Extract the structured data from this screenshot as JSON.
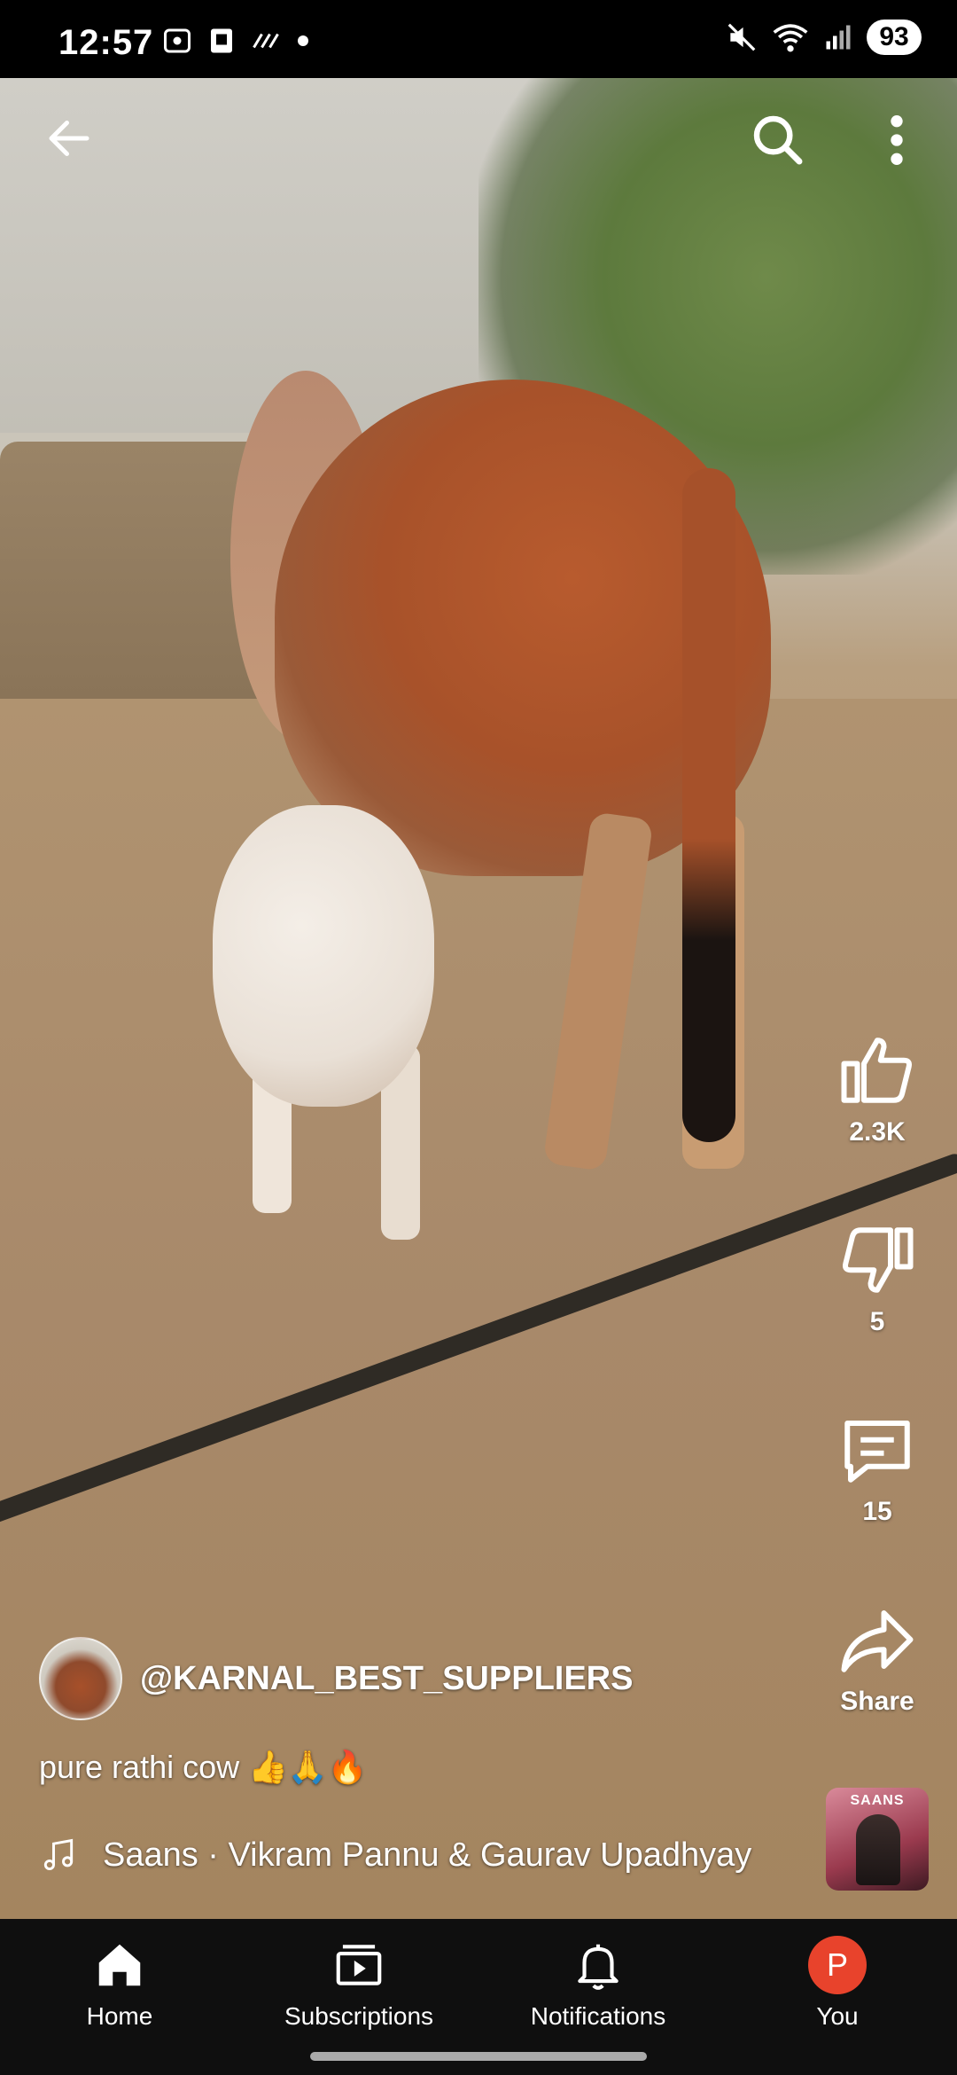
{
  "status_bar": {
    "time": "12:57",
    "battery": "93",
    "icons": [
      "screenshot-icon",
      "sim-icon",
      "dots-icon",
      "mute-icon",
      "wifi-icon",
      "signal-icon"
    ]
  },
  "top_bar": {
    "back_icon": "arrow-back-icon",
    "search_icon": "search-icon",
    "more_icon": "more-vert-icon"
  },
  "actions": {
    "like_count": "2.3K",
    "dislike_count": "5",
    "comment_count": "15",
    "share_label": "Share"
  },
  "video_info": {
    "channel_handle": "@KARNAL_BEST_SUPPLIERS",
    "caption": "pure rathi cow 👍🙏🔥",
    "music": "Saans · Vikram Pannu & Gaurav Upadhyay",
    "music_thumb_title": "SAANS"
  },
  "bottom_nav": {
    "items": [
      {
        "label": "Home"
      },
      {
        "label": "Subscriptions"
      },
      {
        "label": "Notifications"
      },
      {
        "label": "You"
      }
    ],
    "you_initial": "P"
  },
  "colors": {
    "nav_background": "#0f0f0f",
    "avatar_you": "#e8432c"
  }
}
